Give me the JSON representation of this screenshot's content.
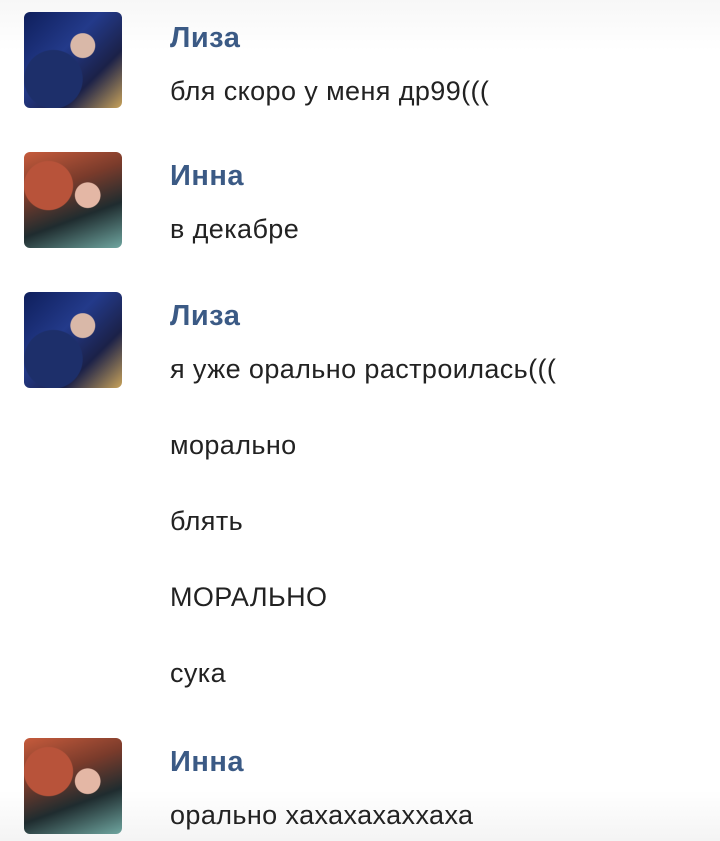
{
  "messages": [
    {
      "sender": "Лиза",
      "avatar": "avatar-liza",
      "lines": [
        "бля скоро у меня др99((("
      ]
    },
    {
      "sender": "Инна",
      "avatar": "avatar-inna",
      "lines": [
        "в декабре"
      ]
    },
    {
      "sender": "Лиза",
      "avatar": "avatar-liza",
      "lines": [
        "я уже орально растроилась(((",
        "морально",
        "блять",
        "МОРАЛЬНО",
        "сука"
      ]
    },
    {
      "sender": "Инна",
      "avatar": "avatar-inna",
      "lines": [
        "орально хахахахаххаха"
      ]
    }
  ],
  "colors": {
    "sender_name": "#3b5a85",
    "message_text": "#222222",
    "background": "#ffffff"
  }
}
